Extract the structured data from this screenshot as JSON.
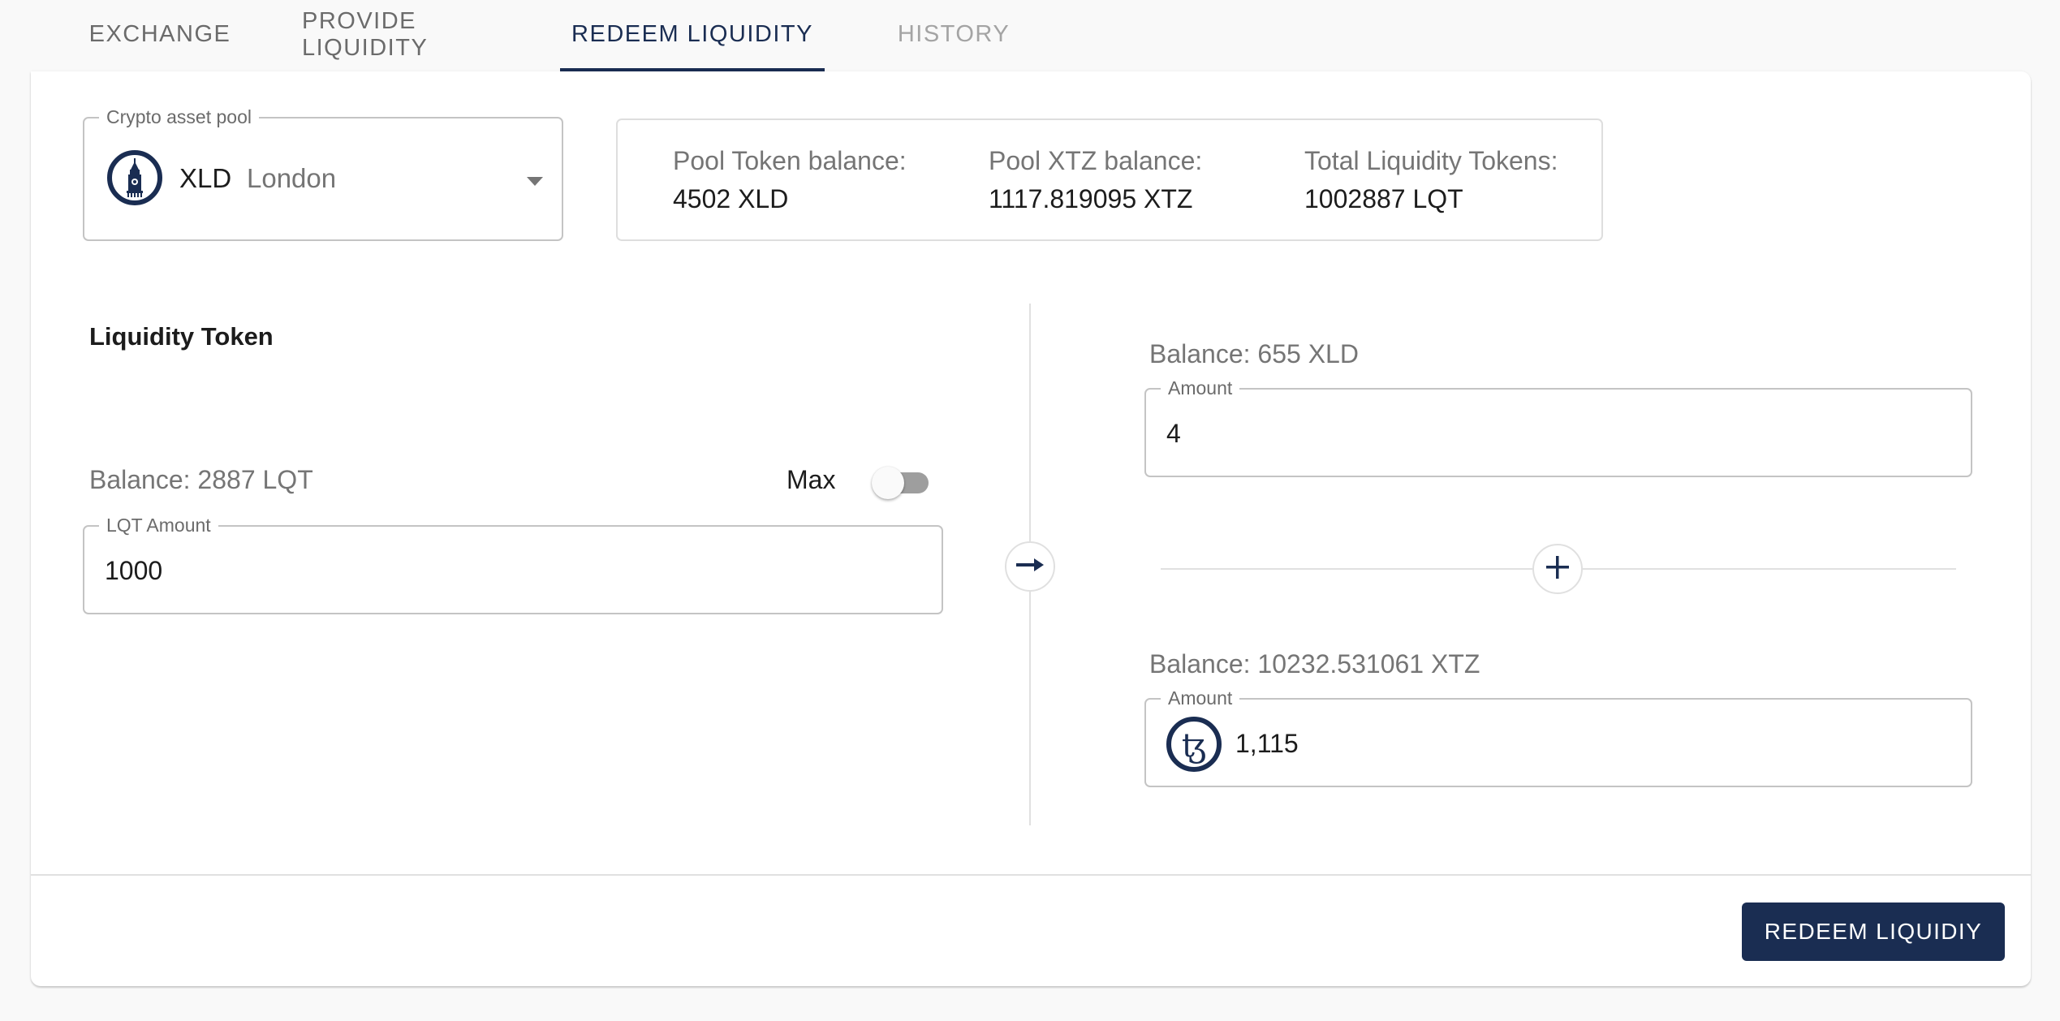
{
  "tabs": [
    {
      "label": "EXCHANGE",
      "state": "default"
    },
    {
      "label": "PROVIDE LIQUIDITY",
      "state": "default"
    },
    {
      "label": "REDEEM LIQUIDITY",
      "state": "active"
    },
    {
      "label": "HISTORY",
      "state": "disabled"
    }
  ],
  "pool_select": {
    "legend": "Crypto asset pool",
    "icon": "big-ben-clock-tower-icon",
    "symbol": "XLD",
    "name": "London"
  },
  "pool_stats": [
    {
      "label": "Pool Token balance:",
      "value": "4502 XLD"
    },
    {
      "label": "Pool XTZ balance:",
      "value": "1117.819095 XTZ"
    },
    {
      "label": "Total Liquidity Tokens:",
      "value": "1002887 LQT"
    }
  ],
  "liquidity_token": {
    "title": "Liquidity Token",
    "balance": "Balance: 2887 LQT",
    "max_label": "Max",
    "max_enabled": false,
    "field_legend": "LQT Amount",
    "field_value": "1000"
  },
  "arrow_icon": "arrow-right-icon",
  "plus_icon": "plus-icon",
  "token_output": {
    "balance": "Balance: 655 XLD",
    "field_legend": "Amount",
    "field_value": "4"
  },
  "xtz_output": {
    "balance": "Balance: 10232.531061 XTZ",
    "field_legend": "Amount",
    "icon": "tezos-icon",
    "field_value": "1,115"
  },
  "footer": {
    "redeem_button_label": "REDEEM LIQUIDIY"
  },
  "colors": {
    "accent": "#1a2d52",
    "background": "#f9f9f9",
    "muted_text": "#757575",
    "border": "#c4c4c4"
  }
}
